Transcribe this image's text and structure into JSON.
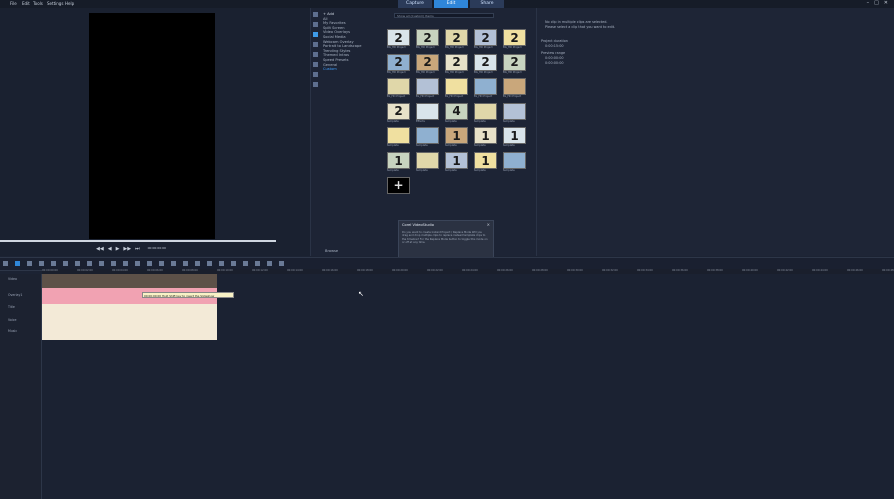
{
  "menu": [
    "File",
    "Edit",
    "Tools",
    "Settings",
    "Help"
  ],
  "mode_tabs": [
    {
      "label": "Capture",
      "active": false
    },
    {
      "label": "Edit",
      "active": true
    },
    {
      "label": "Share",
      "active": false
    }
  ],
  "window_controls": [
    "–",
    "□",
    "✕"
  ],
  "library": {
    "add_label": "Add",
    "folders": [
      "All",
      "My Favorites",
      "Split Screen",
      "Video Overlays",
      "Social Media",
      "Webcam Overlay",
      "Portrait to Landscape",
      "Trending Styles",
      "Themed Intros",
      "Speed Presets",
      "General",
      "Custom"
    ],
    "active_folder": "Custom",
    "browse_label": "Browse",
    "filter_placeholder": "Show all (Custom) Items",
    "thumbnails": [
      {
        "glyph": "2",
        "caption": "BG_HD Project"
      },
      {
        "glyph": "2",
        "caption": "BG_HD Project"
      },
      {
        "glyph": "2",
        "caption": "BG_HD Project"
      },
      {
        "glyph": "2",
        "caption": "BG_HD Project"
      },
      {
        "glyph": "2",
        "caption": "BG_HD Project"
      },
      {
        "glyph": "2",
        "caption": "BG_HD Project"
      },
      {
        "glyph": "2",
        "caption": "BG_HD Project"
      },
      {
        "glyph": "2",
        "caption": "BG_HD Project"
      },
      {
        "glyph": "2",
        "caption": "BG_HD Project"
      },
      {
        "glyph": "2",
        "caption": "BG_HD Project"
      },
      {
        "glyph": "",
        "caption": "BL_HD Project"
      },
      {
        "glyph": "",
        "caption": "BL_HD Project"
      },
      {
        "glyph": "",
        "caption": "BL_HD Project"
      },
      {
        "glyph": "",
        "caption": "BL_HD Project"
      },
      {
        "glyph": "",
        "caption": "BL_HD Project"
      },
      {
        "glyph": "2",
        "caption": "template"
      },
      {
        "glyph": "",
        "caption": "Effects"
      },
      {
        "glyph": "4",
        "caption": "template"
      },
      {
        "glyph": "",
        "caption": "template"
      },
      {
        "glyph": "",
        "caption": "template"
      },
      {
        "glyph": "",
        "caption": "template"
      },
      {
        "glyph": "",
        "caption": "template"
      },
      {
        "glyph": "1",
        "caption": "template"
      },
      {
        "glyph": "1",
        "caption": "template"
      },
      {
        "glyph": "1",
        "caption": "template"
      },
      {
        "glyph": "1",
        "caption": "template"
      },
      {
        "glyph": "",
        "caption": "template"
      },
      {
        "glyph": "1",
        "caption": "template"
      },
      {
        "glyph": "1",
        "caption": "template"
      },
      {
        "glyph": "",
        "caption": "template"
      },
      {
        "glyph": "+",
        "caption": ""
      }
    ]
  },
  "dialog": {
    "title": "Corel VideoStudio",
    "body": "Do you want to create Instant Project / Replace Mode Will you drag and drop multiple clips to replace instead template clips to the timeline? For the Replace Mode button to toggle this mode on or off at any time.",
    "dont_show": "Don't show this message next time",
    "ok": "OK",
    "no": "No"
  },
  "options": {
    "line1": "No clip in multiple clips are selected.",
    "line2": "Please select a clip that you want to edit.",
    "project_duration": "Project duration",
    "duration_time": "0:00:15:00",
    "preview_range": "Preview range",
    "range_start": "0:00:00:00",
    "range_end": "0:00:00:00"
  },
  "preview": {
    "timecode": "00:00:00:00",
    "transport": [
      "◀◀",
      "◀",
      "▶",
      "▶▶",
      "⏭"
    ]
  },
  "ruler": [
    "00:00:00:00",
    "00:00:02:00",
    "00:00:04:00",
    "00:00:06:00",
    "00:00:08:00",
    "00:00:10:00",
    "00:00:12:00",
    "00:00:14:00",
    "00:00:16:00",
    "00:00:18:00",
    "00:00:20:00",
    "00:00:22:00",
    "00:00:24:00",
    "00:00:26:00",
    "00:00:28:00",
    "00:00:30:00",
    "00:00:32:00",
    "00:00:34:00",
    "00:00:36:00",
    "00:00:38:00",
    "00:00:40:00",
    "00:00:42:00",
    "00:00:44:00",
    "00:00:46:00",
    "00:00:48:00",
    "00:00:50:00"
  ],
  "tracks": [
    "Video",
    "Overlay1",
    "Title",
    "Voice",
    "Music"
  ],
  "clip_tooltip": "00:00:00:00 Hold Shift key to insert the Slideshow"
}
